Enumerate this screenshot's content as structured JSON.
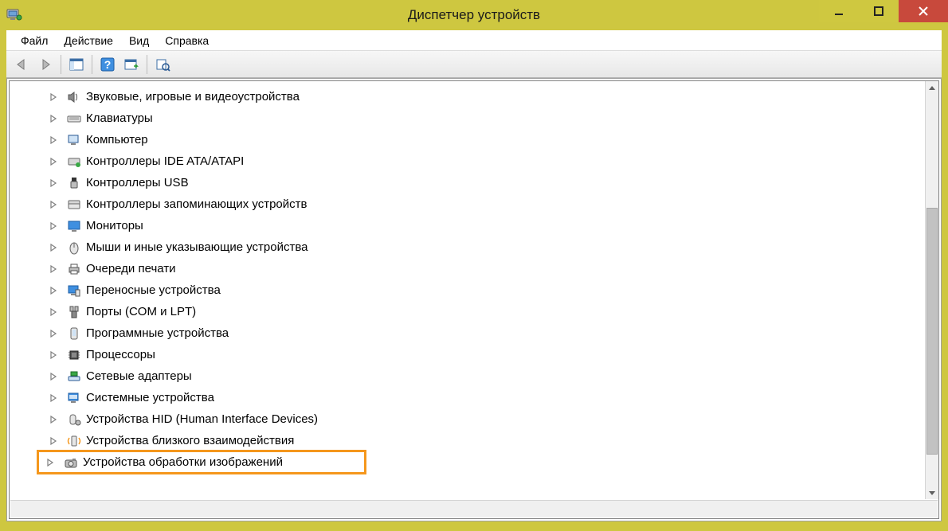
{
  "window": {
    "title": "Диспетчер устройств"
  },
  "menu": {
    "items": [
      {
        "label": "Файл"
      },
      {
        "label": "Действие"
      },
      {
        "label": "Вид"
      },
      {
        "label": "Справка"
      }
    ]
  },
  "toolbar": {
    "back_name": "nav-back",
    "fwd_name": "nav-forward",
    "showhide_name": "show-hide-console-tree",
    "help_name": "help",
    "scan_name": "scan-hardware",
    "props_name": "properties"
  },
  "tree": {
    "items": [
      {
        "icon": "sound-icon",
        "label": "Звуковые, игровые и видеоустройства",
        "highlight": false
      },
      {
        "icon": "keyboard-icon",
        "label": "Клавиатуры",
        "highlight": false
      },
      {
        "icon": "computer-icon",
        "label": "Компьютер",
        "highlight": false
      },
      {
        "icon": "ide-icon",
        "label": "Контроллеры IDE ATA/ATAPI",
        "highlight": false
      },
      {
        "icon": "usb-icon",
        "label": "Контроллеры USB",
        "highlight": false
      },
      {
        "icon": "storage-icon",
        "label": "Контроллеры запоминающих устройств",
        "highlight": false
      },
      {
        "icon": "monitor-icon",
        "label": "Мониторы",
        "highlight": false
      },
      {
        "icon": "mouse-icon",
        "label": "Мыши и иные указывающие устройства",
        "highlight": false
      },
      {
        "icon": "printer-icon",
        "label": "Очереди печати",
        "highlight": false
      },
      {
        "icon": "portable-icon",
        "label": "Переносные устройства",
        "highlight": false
      },
      {
        "icon": "ports-icon",
        "label": "Порты (COM и LPT)",
        "highlight": false
      },
      {
        "icon": "software-icon",
        "label": "Программные устройства",
        "highlight": false
      },
      {
        "icon": "cpu-icon",
        "label": "Процессоры",
        "highlight": false
      },
      {
        "icon": "network-icon",
        "label": "Сетевые адаптеры",
        "highlight": false
      },
      {
        "icon": "system-icon",
        "label": "Системные устройства",
        "highlight": false
      },
      {
        "icon": "hid-icon",
        "label": "Устройства HID (Human Interface Devices)",
        "highlight": false
      },
      {
        "icon": "proximity-icon",
        "label": "Устройства близкого взаимодействия",
        "highlight": false
      },
      {
        "icon": "imaging-icon",
        "label": "Устройства обработки изображений",
        "highlight": true
      }
    ]
  },
  "scrollbar": {
    "thumb_top_pct": 29,
    "thumb_height_pct": 63
  }
}
